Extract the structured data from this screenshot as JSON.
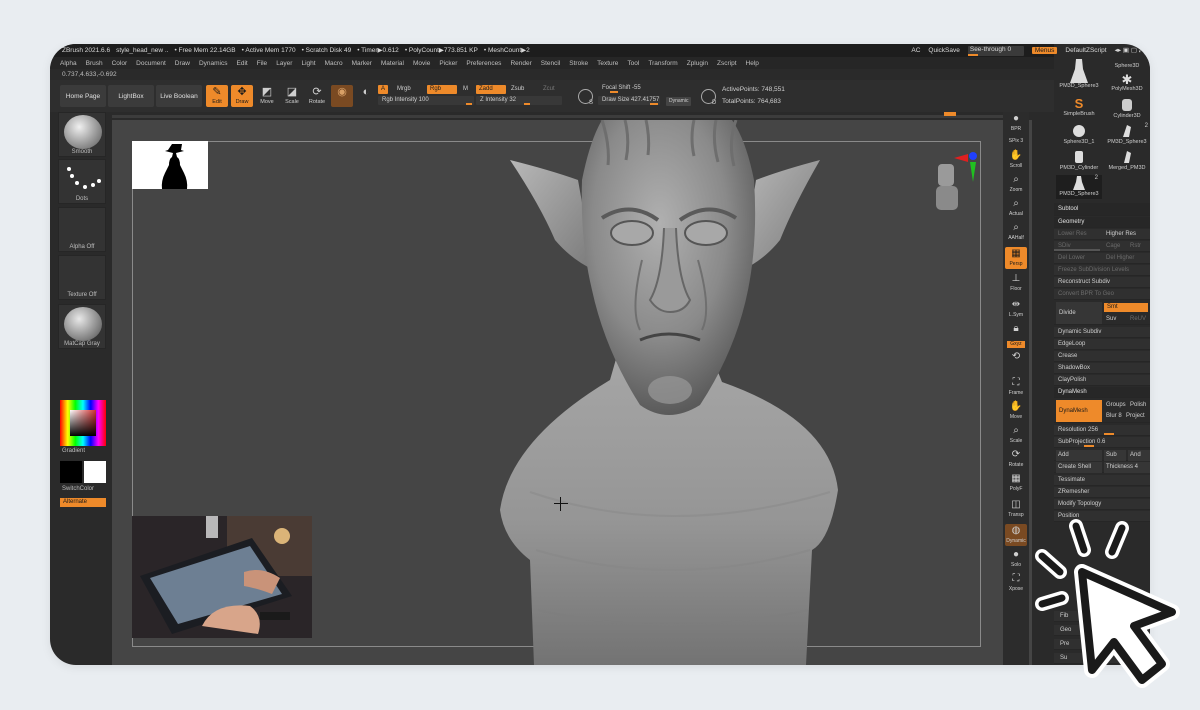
{
  "window": {
    "title": "ZBrush 2021.6.6",
    "doc": "style_head_new ..",
    "free_mem": "• Free Mem 22.14GB",
    "active_mem": "• Active Mem 1770",
    "scratch": "• Scratch Disk 49",
    "timer": "• Timer▶0.612",
    "polycount": "• PolyCount▶773.851 KP",
    "meshcount": "• MeshCount▶2",
    "ac": "AC",
    "quicksave": "QuickSave",
    "see_through": "See-through   0",
    "menus": "Menus",
    "script": "DefaultZScript"
  },
  "menus": [
    "Alpha",
    "Brush",
    "Color",
    "Document",
    "Draw",
    "Dynamics",
    "Edit",
    "File",
    "Layer",
    "Light",
    "Macro",
    "Marker",
    "Material",
    "Movie",
    "Picker",
    "Preferences",
    "Render",
    "Stencil",
    "Stroke",
    "Texture",
    "Tool",
    "Transform",
    "Zplugin",
    "Zscript",
    "Help"
  ],
  "coords": "0.737,4.633,-0.692",
  "toolbar": {
    "home_page": "Home Page",
    "lightbox": "LightBox",
    "live_boolean": "Live Boolean",
    "edit": "Edit",
    "draw": "Draw",
    "move": "Move",
    "scale": "Scale",
    "rotate": "Rotate",
    "a": "A",
    "mrgb": "Mrgb",
    "rgb": "Rgb",
    "m": "M",
    "rgb_intensity": "Rgb Intensity 100",
    "zadd": "Zadd",
    "zsub": "Zsub",
    "zcut": "Zcut",
    "z_intensity": "Z Intensity 32",
    "focal_shift": "Focal Shift -55",
    "draw_size": "Draw Size 427.41757",
    "dynamic": "Dynamic",
    "active_points": "ActivePoints: 748,551",
    "total_points": "TotalPoints: 764,683",
    "s_label": "S",
    "d_label": "D"
  },
  "left_shelf": {
    "smooth": "Smooth",
    "dots": "Dots",
    "alpha_off": "Alpha Off",
    "texture_off": "Texture Off",
    "matcap": "MatCap Gray",
    "gradient": "Gradient",
    "switch_color": "SwitchColor",
    "alternate": "Alternate"
  },
  "right_shelf": {
    "bpr": "BPR",
    "spix": "SPix 3",
    "scroll": "Scroll",
    "zoom": "Zoom",
    "actual": "Actual",
    "aahalf": "AAHalf",
    "persp": "Persp",
    "floor": "Floor",
    "lsym": "L.Sym",
    "gxyz": "Gxyz",
    "frame": "Frame",
    "move": "Move",
    "scale": "Scale",
    "rotate": "Rotate",
    "polyf": "PolyF",
    "transp": "Transp",
    "dynamic": "Dynamic",
    "solo": "Solo",
    "xpose": "Xpose"
  },
  "tool_panel": {
    "tools": [
      {
        "label": "PM3D_Sphere3"
      },
      {
        "label": "Sphere3D"
      },
      {
        "label": "PolyMesh3D"
      },
      {
        "label": "SimpleBrush"
      },
      {
        "label": "Cylinder3D"
      },
      {
        "label": "Sphere3D_1"
      },
      {
        "label": "PM3D_Sphere3"
      },
      {
        "label": "PM3D_Cylinder"
      },
      {
        "label": "Merged_PM3D"
      },
      {
        "label": "PM3D_Sphere3"
      }
    ],
    "badge_2": "2",
    "subtool": "Subtool",
    "geometry": "Geometry",
    "lower_res": "Lower Res",
    "higher_res": "Higher Res",
    "sdiv": "SDiv",
    "cage": "Cage",
    "rstr": "Rstr",
    "del_lower": "Del Lower",
    "del_higher": "Del Higher",
    "freeze": "Freeze SubDivision Levels",
    "reconstruct": "Reconstruct Subdiv",
    "convert_bpr": "Convert BPR To Geo",
    "divide": "Divide",
    "smt": "Smt",
    "suv": "Suv",
    "reuv": "ReUV",
    "dynamic_subdiv": "Dynamic Subdiv",
    "edgeloop": "EdgeLoop",
    "crease": "Crease",
    "shadowbox": "ShadowBox",
    "claypolish": "ClayPolish",
    "dynamesh_head": "DynaMesh",
    "dynamesh_btn": "DynaMesh",
    "groups": "Groups",
    "polish": "Polish",
    "blur": "Blur 8",
    "project": "Project",
    "resolution": "Resolution 256",
    "subprojection": "SubProjection 0.6",
    "add": "Add",
    "sub": "Sub",
    "and": "And",
    "create_shell": "Create Shell",
    "thickness": "Thickness 4",
    "tessimate": "Tessimate",
    "zremesher": "ZRemesher",
    "modify_topology": "Modify Topology",
    "position": "Position",
    "fib": "Fib",
    "geo": "Geo",
    "pre": "Pre",
    "su": "Su"
  },
  "colors": {
    "accent": "#ee8a2a",
    "panel": "#2a2a2a",
    "viewport": "#454545"
  }
}
